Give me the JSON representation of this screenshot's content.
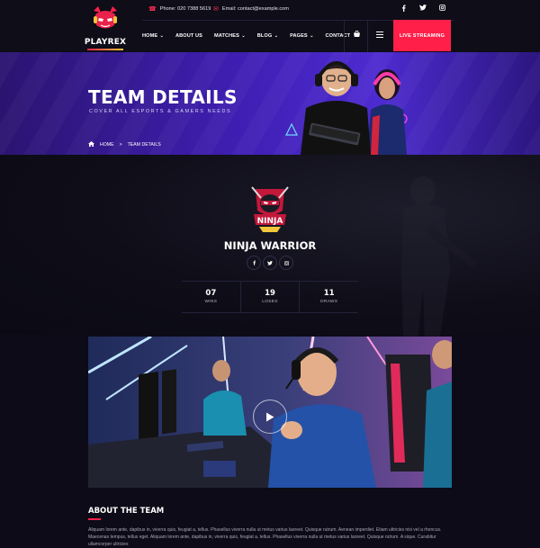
{
  "brand": {
    "name": "PLAYREX"
  },
  "contact": {
    "phone": "Phone: 020 7388 5619",
    "email": "Email: contact@example.com"
  },
  "social_top": {
    "facebook": "f",
    "twitter": "t",
    "instagram": "ig"
  },
  "nav": {
    "items": [
      {
        "label": "HOME",
        "has_dropdown": true
      },
      {
        "label": "ABOUT US",
        "has_dropdown": false
      },
      {
        "label": "MATCHES",
        "has_dropdown": true
      },
      {
        "label": "BLOG",
        "has_dropdown": true
      },
      {
        "label": "PAGES",
        "has_dropdown": true
      },
      {
        "label": "CONTACT",
        "has_dropdown": false
      }
    ],
    "cta": "LIVE STREAMING"
  },
  "banner": {
    "title": "TEAM DETAILS",
    "subtitle": "COVER ALL ESPORTS & GAMERS NEEDS",
    "breadcrumb": {
      "home": "HOME",
      "separator": ">",
      "current": "TEAM DETAILS"
    }
  },
  "team": {
    "name": "NINJA WARRIOR",
    "logo_text": "NINJA",
    "stats": [
      {
        "value": "07",
        "label": "WINS"
      },
      {
        "value": "19",
        "label": "LOSES"
      },
      {
        "value": "11",
        "label": "DRAWS"
      }
    ]
  },
  "about": {
    "title": "ABOUT THE TEAM",
    "text": "Aliquam lorem ante, dapibus in, viverra quis, feugiat a, tellus. Phasellus viverra nulla ut metus varius laoreet. Quisque rutrum. Aenean imperdiet. Etiam ultricies nisi vel a rhoncus. Maecenas tempus, tellus eget. Aliquam lorem ante, dapibus in, viverra quis, feugiat a, tellus. Phasellus viverra nulla ut metus varius laoreet. Quisque rutrum. A sique. Curabitur ullamcorper ultricies"
  },
  "colors": {
    "accent": "#ff1f48",
    "banner": "#3f1fb4",
    "background": "#0c0b17"
  }
}
